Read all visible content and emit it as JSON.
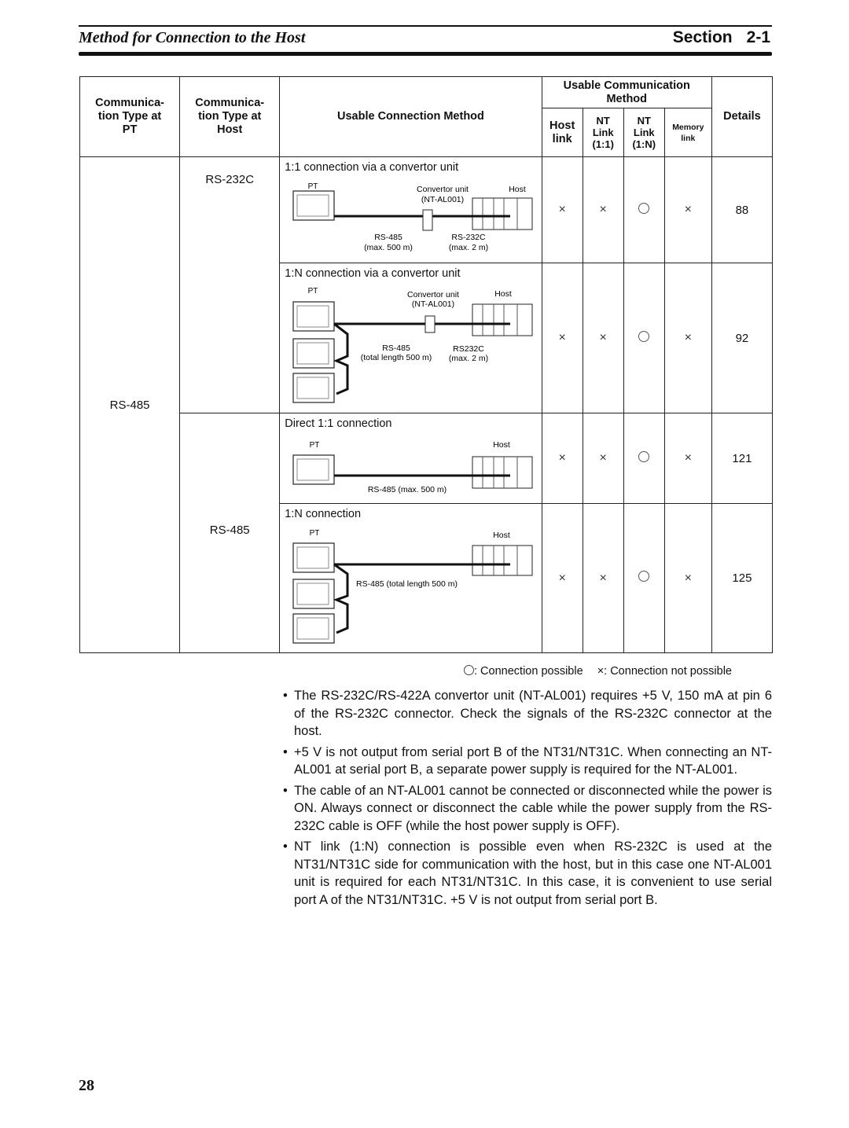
{
  "header": {
    "title": "Method for Connection to the Host",
    "section_label": "Section",
    "section_number": "2-1"
  },
  "table": {
    "headers": {
      "pt_type": [
        "Communica-",
        "tion Type at",
        "PT"
      ],
      "host_type": [
        "Communica-",
        "tion Type at",
        "Host"
      ],
      "method": "Usable Connection Method",
      "comm_group": [
        "Usable Communication",
        "Method"
      ],
      "host_link": [
        "Host",
        "link"
      ],
      "nt_link_11": [
        "NT",
        "Link",
        "(1:1)"
      ],
      "nt_link_1n": [
        "NT",
        "Link",
        "(1:N)"
      ],
      "memory_link": [
        "Memory",
        "link"
      ],
      "details": "Details"
    },
    "pt_type_value": "RS-485",
    "host_groups": [
      {
        "host_type": "RS-232C"
      },
      {
        "host_type": "RS-485"
      }
    ],
    "rows": [
      {
        "title": "1:1 connection via a convertor unit",
        "labels": {
          "pt": "PT",
          "conv": "Convertor unit",
          "conv_model": "(NT-AL001)",
          "host": "Host",
          "rs485": "RS-485",
          "rs485_len": "(max. 500 m)",
          "rs232": "RS-232C",
          "rs232_len": "(max. 2 m)"
        },
        "host_link": "×",
        "nt_link_11": "×",
        "nt_link_1n": "○",
        "memory_link": "×",
        "details": "88"
      },
      {
        "title": "1:N connection via a convertor unit",
        "labels": {
          "pt": "PT",
          "conv": "Convertor unit",
          "conv_model": "(NT-AL001)",
          "host": "Host",
          "rs485": "RS-485",
          "rs485_len": "(total length 500 m)",
          "rs232": "RS232C",
          "rs232_len": "(max. 2 m)"
        },
        "host_link": "×",
        "nt_link_11": "×",
        "nt_link_1n": "○",
        "memory_link": "×",
        "details": "92"
      },
      {
        "title": "Direct 1:1 connection",
        "labels": {
          "pt": "PT",
          "host": "Host",
          "cable": "RS-485 (max. 500 m)"
        },
        "host_link": "×",
        "nt_link_11": "×",
        "nt_link_1n": "○",
        "memory_link": "×",
        "details": "121"
      },
      {
        "title": "1:N connection",
        "labels": {
          "pt": "PT",
          "host": "Host",
          "cable": "RS-485 (total length 500 m)"
        },
        "host_link": "×",
        "nt_link_11": "×",
        "nt_link_1n": "○",
        "memory_link": "×",
        "details": "125"
      }
    ]
  },
  "legend": {
    "possible": ": Connection possible",
    "not_possible_symbol": "×",
    "not_possible": ": Connection not possible"
  },
  "notes": [
    "The RS-232C/RS-422A convertor unit (NT-AL001) requires +5 V, 150 mA at pin 6 of the RS-232C connector. Check the signals of the RS-232C connector at the host.",
    "+5 V is not output from serial port B of the NT31/NT31C. When connecting an NT-AL001 at serial port B, a separate power supply is required for the NT-AL001.",
    "The cable of an NT-AL001 cannot be connected or disconnected while the power is ON. Always connect or disconnect the cable while the power supply from the RS-232C cable is OFF (while the host power supply is OFF).",
    "NT link (1:N) connection is possible even when RS-232C is used at the NT31/NT31C side for communication with the host, but in this case one NT-AL001 unit is required for each NT31/NT31C. In this case, it is convenient to use serial port A of the NT31/NT31C. +5 V is not output from serial port B."
  ],
  "page_number": "28"
}
